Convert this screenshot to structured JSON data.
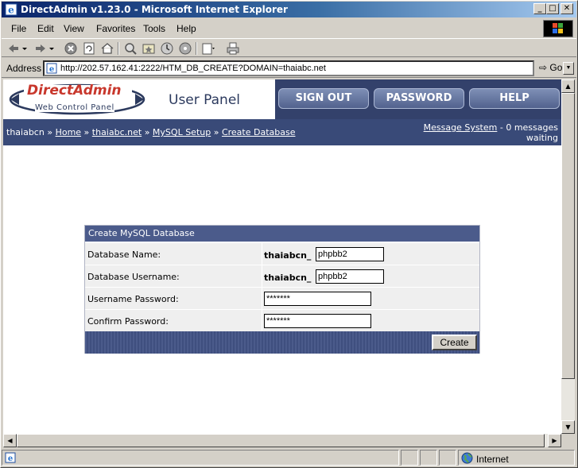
{
  "window": {
    "title": "DirectAdmin v1.23.0 - Microsoft Internet Explorer",
    "controls": [
      "minimize",
      "maximize",
      "close"
    ]
  },
  "menu": {
    "items": [
      {
        "label": "File",
        "accel": "F"
      },
      {
        "label": "Edit",
        "accel": "E"
      },
      {
        "label": "View",
        "accel": "V"
      },
      {
        "label": "Favorites",
        "accel": "a"
      },
      {
        "label": "Tools",
        "accel": "T"
      },
      {
        "label": "Help",
        "accel": "H"
      }
    ]
  },
  "toolbar": {
    "icons": [
      "back-icon",
      "back-dropdown-icon",
      "forward-icon",
      "forward-dropdown-icon",
      "stop-icon",
      "refresh-icon",
      "home-icon",
      "search-icon",
      "favorites-icon",
      "history-icon",
      "media-icon",
      "mail-icon",
      "print-icon"
    ]
  },
  "address": {
    "label": "Address",
    "url": "http://202.57.162.41:2222/HTM_DB_CREATE?DOMAIN=thaiabc.net",
    "go_label": "Go"
  },
  "header": {
    "logo_text": "DirectAdmin",
    "logo_subtext": "Web Control Panel",
    "panel_title": "User Panel",
    "nav": [
      "SIGN OUT",
      "PASSWORD",
      "HELP"
    ]
  },
  "breadcrumb": {
    "user": "thaiabcn",
    "sep": "»",
    "links": [
      "Home",
      "thaiabc.net",
      "MySQL Setup",
      "Create Database"
    ]
  },
  "messages": {
    "link": "Message System",
    "text": "- 0 messages",
    "text2": "waiting"
  },
  "form": {
    "title": "Create MySQL Database",
    "prefix": "thaiabcn_",
    "rows": [
      {
        "label": "Database Name:",
        "value": "phpbb2"
      },
      {
        "label": "Database Username:",
        "value": "phpbb2"
      },
      {
        "label": "Username Password:",
        "value": "*******"
      },
      {
        "label": "Confirm Password:",
        "value": "*******"
      }
    ],
    "submit": "Create"
  },
  "status": {
    "zone": "Internet"
  },
  "colors": {
    "title_gradient_start": "#0a246a",
    "da_dark_blue": "#33416b",
    "da_crumb_blue": "#394a78",
    "form_header": "#4b5b8b",
    "row_background": "#efefef"
  }
}
